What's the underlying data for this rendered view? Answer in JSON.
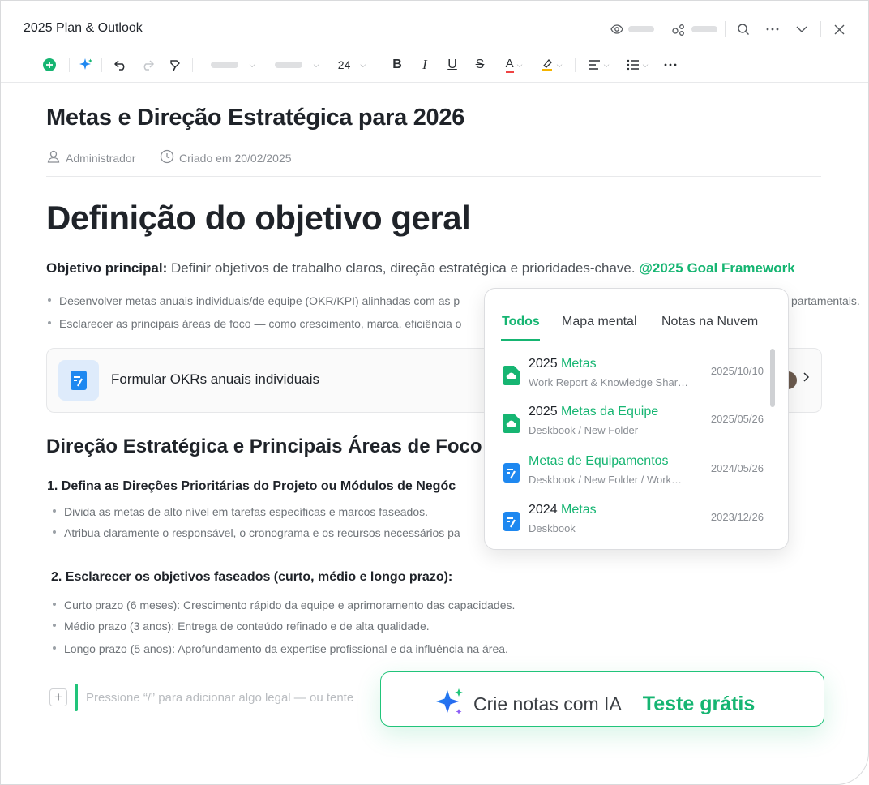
{
  "app": {
    "title": "2025 Plan & Outlook"
  },
  "toolbar": {
    "font_size": "24",
    "bold": "B",
    "italic": "I",
    "underline": "U",
    "strike": "S",
    "font_color": "A"
  },
  "document": {
    "title": "Metas e Direção Estratégica para 2026",
    "author": "Administrador",
    "created": "Criado em 20/02/2025",
    "heading1": "Definição do objetivo geral",
    "main_objective_label": "Objetivo principal:",
    "main_objective_text": " Definir objetivos de trabalho claros, direção estratégica e prioridades-chave. ",
    "mention": "@2025 Goal Framework",
    "bullets_top": [
      "Desenvolver metas anuais individuais/de equipe (OKR/KPI) alinhadas com as p",
      "Esclarecer as principais áreas de foco — como crescimento, marca, eficiência o"
    ],
    "bullet_top_tail": "partamentais.",
    "card_label": "Formular OKRs anuais individuais",
    "heading2": "Direção Estratégica e Principais Áreas de Foco",
    "section1": {
      "title": "1. Defina as Direções Prioritárias do Projeto ou Módulos de Negóc",
      "bullets": [
        "Divida as metas de alto nível em tarefas específicas e marcos faseados.",
        "Atribua claramente o responsável, o cronograma e os recursos necessários pa"
      ]
    },
    "section2": {
      "title": "2. Esclarecer os objetivos faseados (curto, médio e longo prazo):",
      "bullets": [
        "Curto prazo (6 meses): Crescimento rápido da equipe e aprimoramento das capacidades.",
        "Médio prazo (3 anos): Entrega de conteúdo refinado e de alta qualidade.",
        "Longo prazo (5 anos): Aprofundamento da expertise profissional e da influência na área."
      ]
    },
    "placeholder": "Pressione “/” para adicionar algo legal — ou tente"
  },
  "popup": {
    "tabs": [
      "Todos",
      "Mapa mental",
      "Notas na Nuvem"
    ],
    "active_tab": "Todos",
    "items": [
      {
        "prefix": "2025 ",
        "highlight": "Metas",
        "path": "Work Report & Knowledge Shar…",
        "date": "2025/10/10",
        "icon": "cloud-doc-icon"
      },
      {
        "prefix": "2025 ",
        "highlight": "Metas da Equipe",
        "path": "Deskbook / New Folder",
        "date": "2025/05/26",
        "icon": "cloud-doc-icon"
      },
      {
        "prefix": "",
        "highlight": "Metas de Equipamentos",
        "path": "Deskbook / New Folder / Work…",
        "date": "2024/05/26",
        "icon": "note-doc-icon"
      },
      {
        "prefix": "2024 ",
        "highlight": "Metas",
        "path": "Deskbook",
        "date": "2023/12/26",
        "icon": "note-doc-icon"
      }
    ]
  },
  "cta": {
    "text": "Crie notas com IA",
    "link": "Teste grátis"
  },
  "colors": {
    "accent": "#16b572",
    "blue_icon": "#1e88f0"
  }
}
